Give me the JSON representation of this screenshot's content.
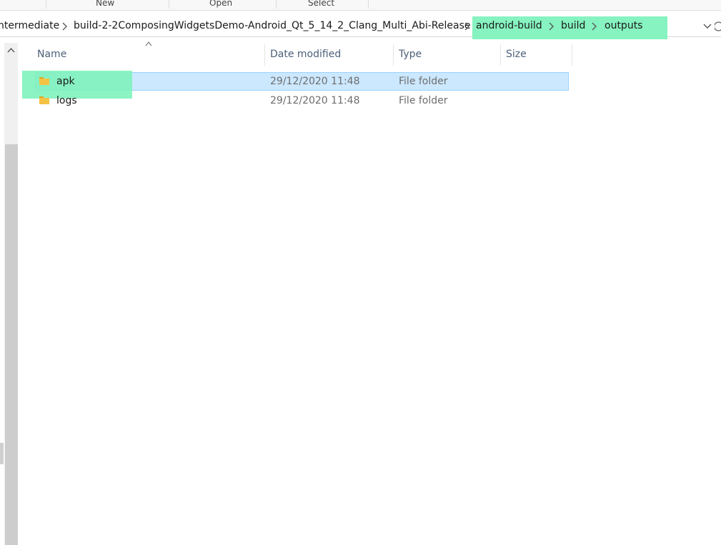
{
  "ribbon": {
    "groups": [
      "New",
      "Open",
      "Select"
    ]
  },
  "address_bar": {
    "crumbs": [
      "ntermediate",
      "build-2-2ComposingWidgetsDemo-Android_Qt_5_14_2_Clang_Multi_Abi-Release",
      "android-build",
      "build",
      "outputs"
    ]
  },
  "columns": {
    "name": "Name",
    "date_modified": "Date modified",
    "type": "Type",
    "size": "Size"
  },
  "files": [
    {
      "name": "apk",
      "date_modified": "29/12/2020 11:48",
      "type": "File folder",
      "size": "",
      "selected": true,
      "icon": "folder-icon"
    },
    {
      "name": "logs",
      "date_modified": "29/12/2020 11:48",
      "type": "File folder",
      "size": "",
      "selected": false,
      "icon": "folder-icon"
    }
  ],
  "colors": {
    "highlight": "#7ff2bd",
    "selection": "#cce8ff",
    "selection_border": "#99d1ff",
    "header_text": "#4c607a",
    "folder": "#f3c343"
  }
}
